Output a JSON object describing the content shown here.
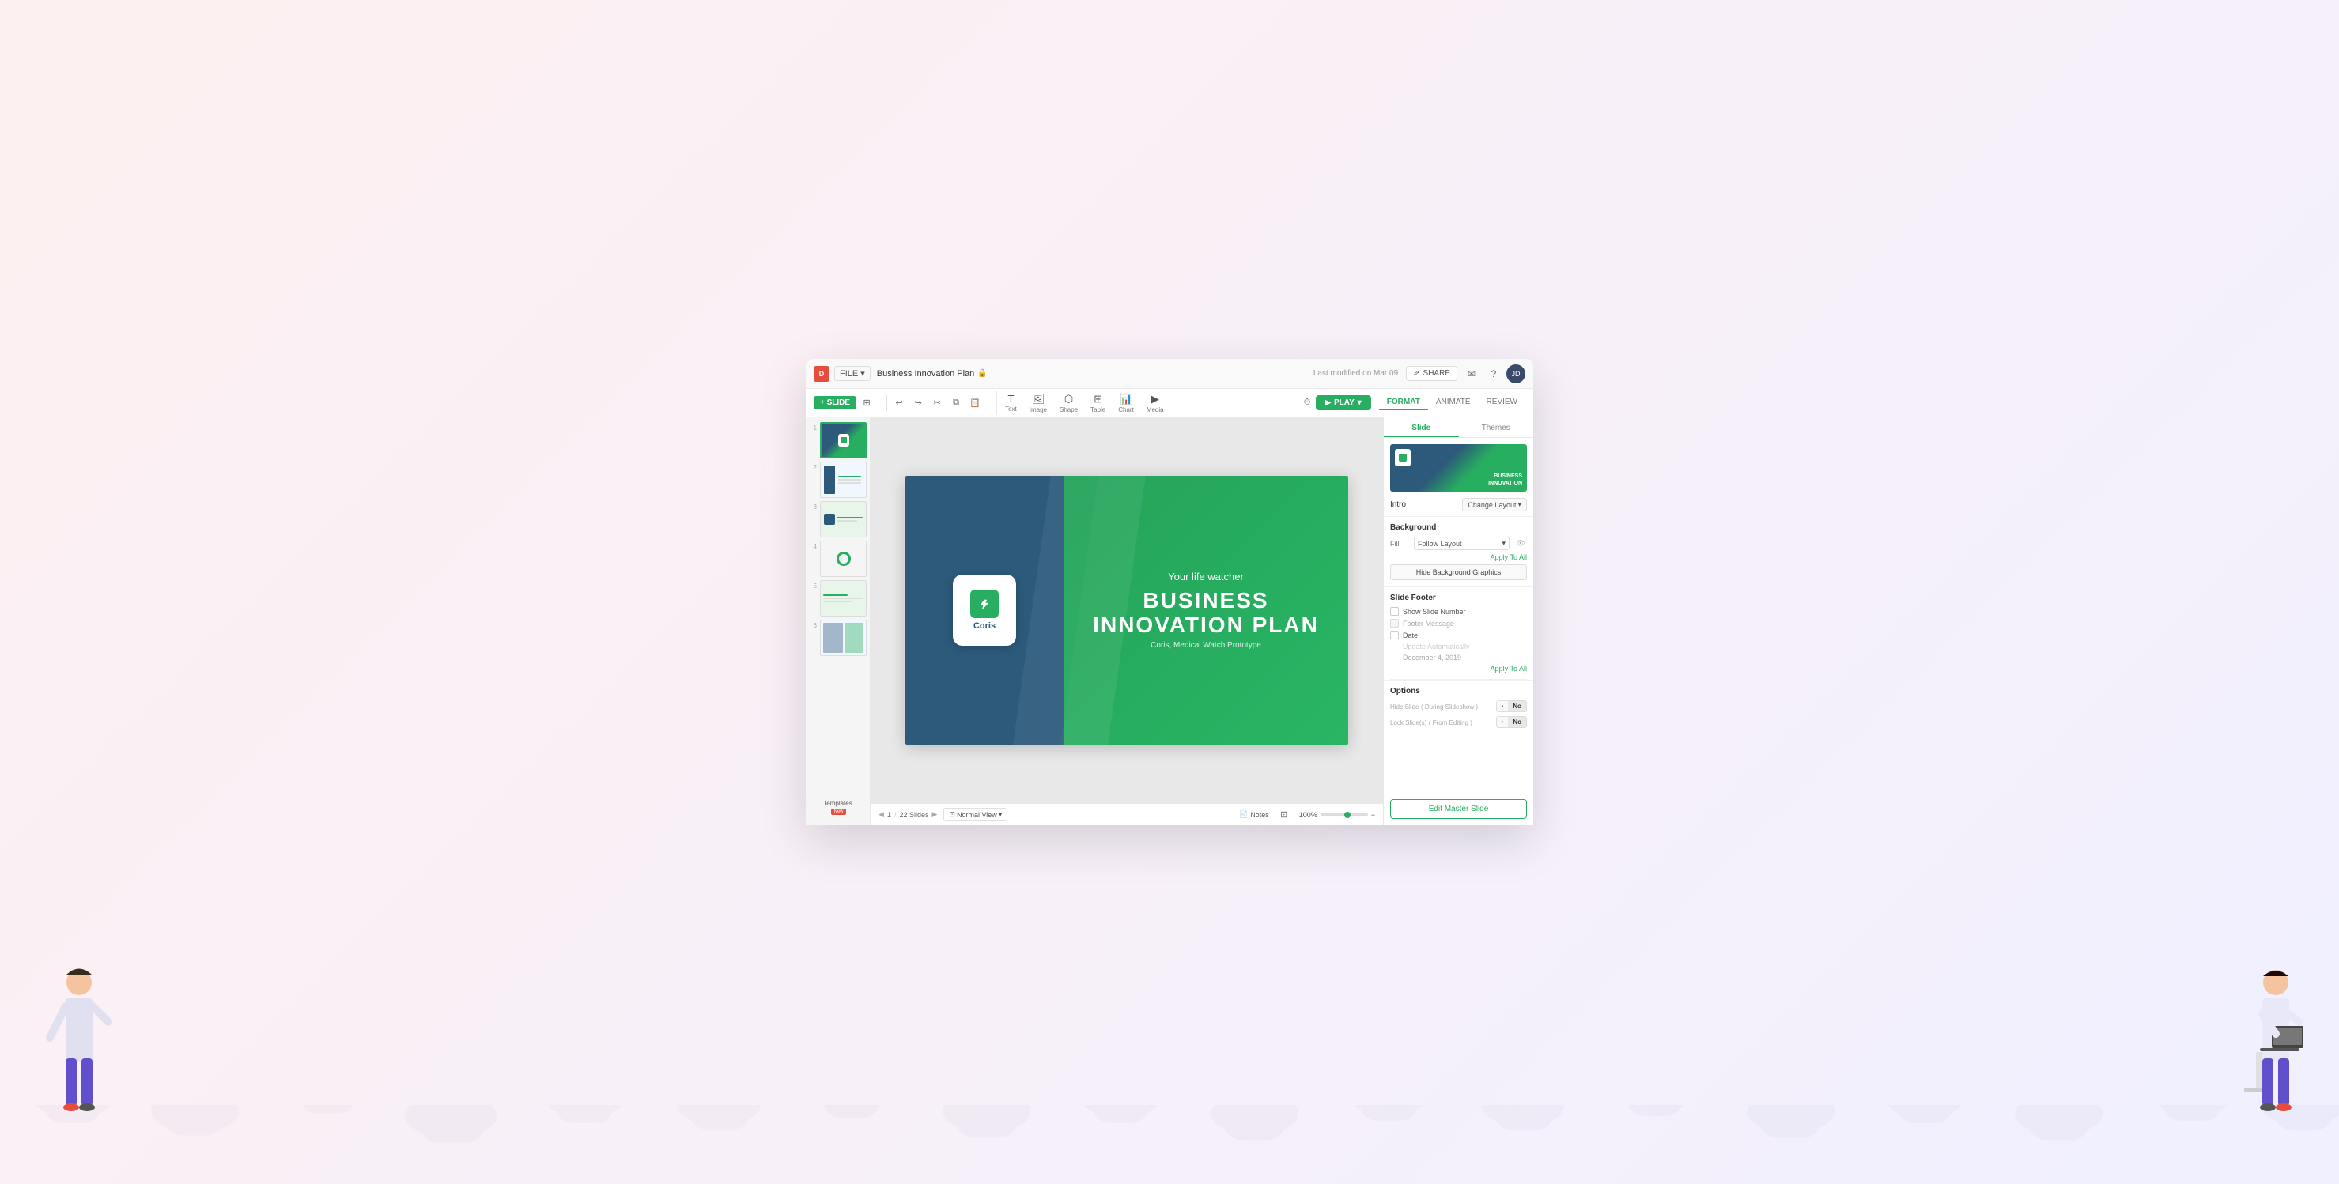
{
  "app": {
    "logo": "D",
    "file_menu": "FILE",
    "doc_title": "Business Innovation Plan",
    "last_modified": "Last modified on Mar 09"
  },
  "toolbar": {
    "slide_add": "+ SLIDE",
    "play_btn": "PLAY",
    "media_tools": [
      {
        "icon": "T",
        "label": "Text"
      },
      {
        "icon": "🖼",
        "label": "Image"
      },
      {
        "icon": "⬡",
        "label": "Shape"
      },
      {
        "icon": "⊞",
        "label": "Table"
      },
      {
        "icon": "📊",
        "label": "Chart"
      },
      {
        "icon": "▶",
        "label": "Media"
      }
    ]
  },
  "format_tabs": [
    {
      "label": "FORMAT",
      "active": true
    },
    {
      "label": "ANIMATE",
      "active": false
    },
    {
      "label": "REVIEW",
      "active": false
    }
  ],
  "slides": [
    {
      "num": "1",
      "active": true
    },
    {
      "num": "2",
      "active": false
    },
    {
      "num": "3",
      "active": false
    },
    {
      "num": "4",
      "active": false
    },
    {
      "num": "5",
      "active": false
    },
    {
      "num": "6",
      "active": false
    }
  ],
  "slide_content": {
    "logo_text": "Coris",
    "tagline": "Your life watcher",
    "title_line1": "BUSINESS",
    "title_line2": "INNOVATION PLAN",
    "subtitle": "Coris, Medical Watch Prototype"
  },
  "status_bar": {
    "current_slide": "1",
    "total_slides": "22 Slides",
    "view_mode": "Normal View",
    "notes_label": "Notes",
    "zoom": "100%"
  },
  "right_panel": {
    "tabs": [
      {
        "label": "Slide",
        "active": true
      },
      {
        "label": "Themes",
        "active": false
      }
    ],
    "layout_name": "Intro",
    "change_layout_btn": "Change Layout",
    "sections": {
      "background": {
        "title": "Background",
        "fill_label": "Fill",
        "fill_value": "Follow Layout",
        "apply_to_all": "Apply To All",
        "hide_bg_btn": "Hide Background Graphics"
      },
      "slide_footer": {
        "title": "Slide Footer",
        "show_slide_number": "Show Slide Number",
        "footer_message": "Footer Message",
        "date_label": "Date",
        "date_placeholder": "Update Automatically",
        "date_value": "December 4, 2019",
        "apply_to_all": "Apply To All"
      },
      "options": {
        "title": "Options",
        "hide_slide_label": "Hide Slide",
        "hide_slide_sub": "( During Slideshow )",
        "hide_slide_off": "No",
        "lock_slide_label": "Lock Slide(s)",
        "lock_slide_sub": "( From Editing )",
        "lock_slide_off": "No"
      }
    },
    "edit_master_btn": "Edit Master Slide"
  },
  "templates_btn": "Templates",
  "templates_new_badge": "New"
}
